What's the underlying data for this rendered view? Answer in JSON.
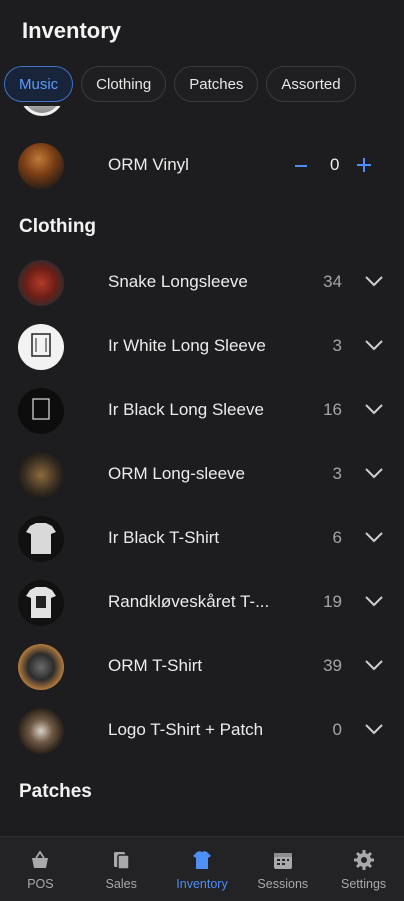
{
  "header": {
    "title": "Inventory"
  },
  "tabs": [
    {
      "label": "Music",
      "active": true
    },
    {
      "label": "Clothing",
      "active": false
    },
    {
      "label": "Patches",
      "active": false
    },
    {
      "label": "Assorted",
      "active": false
    }
  ],
  "music": {
    "items": [
      {
        "name": "ORM Vinyl",
        "quantity": "0"
      }
    ]
  },
  "clothing": {
    "title": "Clothing",
    "items": [
      {
        "name": "Snake Longsleeve",
        "count": "34"
      },
      {
        "name": "Ir White Long Sleeve",
        "count": "3"
      },
      {
        "name": "Ir Black Long Sleeve",
        "count": "16"
      },
      {
        "name": "ORM Long-sleeve",
        "count": "3"
      },
      {
        "name": "Ir Black T-Shirt",
        "count": "6"
      },
      {
        "name": "Randkløveskåret T-...",
        "count": "19"
      },
      {
        "name": "ORM T-Shirt",
        "count": "39"
      },
      {
        "name": "Logo T-Shirt + Patch",
        "count": "0"
      }
    ]
  },
  "patches": {
    "title": "Patches"
  },
  "bottom_nav": [
    {
      "label": "POS",
      "icon": "basket-icon",
      "active": false
    },
    {
      "label": "Sales",
      "icon": "receipt-icon",
      "active": false
    },
    {
      "label": "Inventory",
      "icon": "tshirt-icon",
      "active": true
    },
    {
      "label": "Sessions",
      "icon": "calendar-icon",
      "active": false
    },
    {
      "label": "Settings",
      "icon": "gear-icon",
      "active": false
    }
  ],
  "colors": {
    "background": "#1d1d1f",
    "accent": "#4d8ef7",
    "active_tab_border": "#3f74c7",
    "muted_text": "#a5a5a8"
  }
}
